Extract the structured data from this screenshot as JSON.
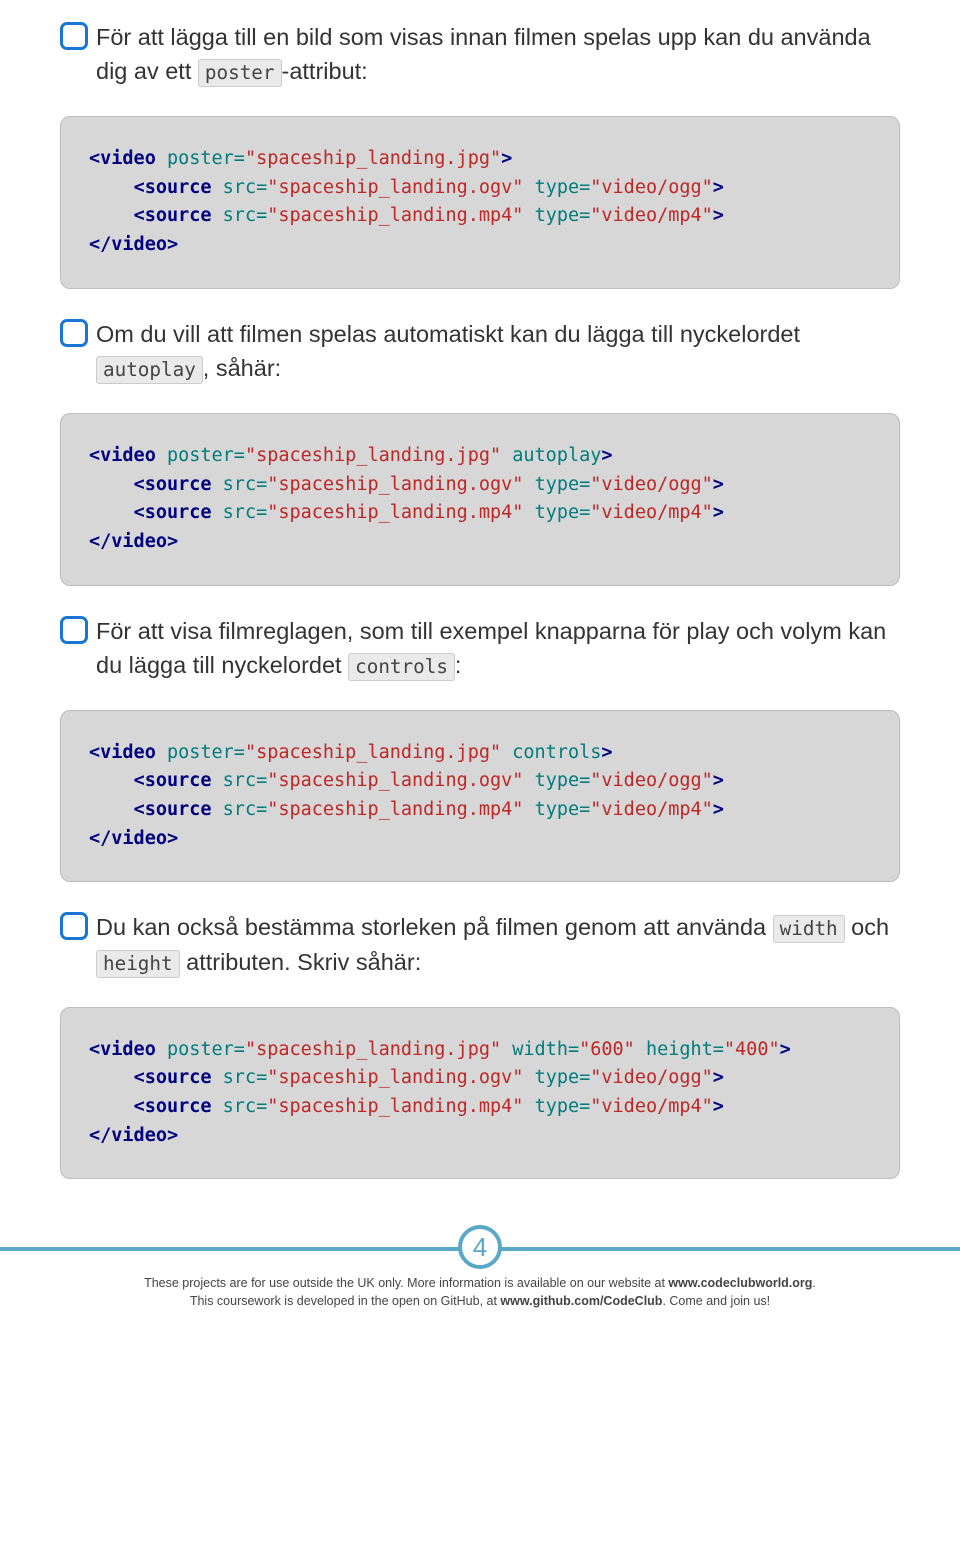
{
  "steps": [
    {
      "prefix": "För att lägga till en bild som visas innan filmen spelas upp kan du använda dig av ett ",
      "kw": "poster",
      "suffix": "-attribut:"
    },
    {
      "prefix": "Om du vill att filmen spelas automatiskt kan du lägga till nyckelordet ",
      "kw": "autoplay",
      "suffix": ", såhär:"
    },
    {
      "prefix": "För att visa filmreglagen, som till exempel knapparna för play och volym kan du lägga till nyckelordet ",
      "kw": "controls",
      "suffix": ":"
    },
    {
      "prefix": "Du kan också bestämma storleken på filmen genom att använda ",
      "kw": "width",
      "mid": " och ",
      "kw2": "height",
      "suffix": " attributen. Skriv såhär:"
    }
  ],
  "code": [
    {
      "open_tag": "video",
      "attrs": [
        [
          "poster",
          "\"spaceship_landing.jpg\""
        ]
      ],
      "sources": [
        [
          [
            "src",
            "\"spaceship_landing.ogv\""
          ],
          [
            "type",
            "\"video/ogg\""
          ]
        ],
        [
          [
            "src",
            "\"spaceship_landing.mp4\""
          ],
          [
            "type",
            "\"video/mp4\""
          ]
        ]
      ],
      "close_tag": "video"
    },
    {
      "open_tag": "video",
      "attrs": [
        [
          "poster",
          "\"spaceship_landing.jpg\""
        ],
        [
          "autoplay",
          null
        ]
      ],
      "sources": [
        [
          [
            "src",
            "\"spaceship_landing.ogv\""
          ],
          [
            "type",
            "\"video/ogg\""
          ]
        ],
        [
          [
            "src",
            "\"spaceship_landing.mp4\""
          ],
          [
            "type",
            "\"video/mp4\""
          ]
        ]
      ],
      "close_tag": "video"
    },
    {
      "open_tag": "video",
      "attrs": [
        [
          "poster",
          "\"spaceship_landing.jpg\""
        ],
        [
          "controls",
          null
        ]
      ],
      "sources": [
        [
          [
            "src",
            "\"spaceship_landing.ogv\""
          ],
          [
            "type",
            "\"video/ogg\""
          ]
        ],
        [
          [
            "src",
            "\"spaceship_landing.mp4\""
          ],
          [
            "type",
            "\"video/mp4\""
          ]
        ]
      ],
      "close_tag": "video"
    },
    {
      "open_tag": "video",
      "attrs": [
        [
          "poster",
          "\"spaceship_landing.jpg\""
        ],
        [
          "width",
          "\"600\""
        ],
        [
          "height",
          "\"400\""
        ]
      ],
      "sources": [
        [
          [
            "src",
            "\"spaceship_landing.ogv\""
          ],
          [
            "type",
            "\"video/ogg\""
          ]
        ],
        [
          [
            "src",
            "\"spaceship_landing.mp4\""
          ],
          [
            "type",
            "\"video/mp4\""
          ]
        ]
      ],
      "close_tag": "video"
    }
  ],
  "page_number": "4",
  "footer": {
    "line1_a": "These projects are for use outside the UK only. More information is available on our website at ",
    "line1_b": "www.codeclubworld.org",
    "line1_c": ".",
    "line2_a": "This coursework is developed in the open on GitHub, at ",
    "line2_b": "www.github.com/CodeClub",
    "line2_c": ". Come and join us!"
  }
}
